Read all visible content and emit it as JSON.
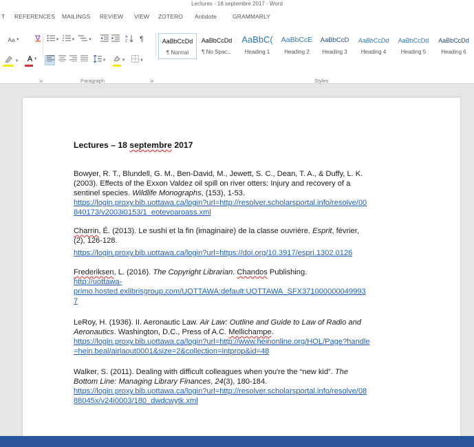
{
  "window": {
    "title": "Lectures - 18 septembre 2017 - Word"
  },
  "tabs": [
    {
      "label": "T"
    },
    {
      "label": "REFERENCES"
    },
    {
      "label": "MAILINGS"
    },
    {
      "label": "REVIEW"
    },
    {
      "label": "VIEW"
    },
    {
      "label": "ZOTERO"
    },
    {
      "label": "Antidote"
    },
    {
      "label": "GRAMMARLY"
    }
  ],
  "ribbon": {
    "font_size_glyph": "Aa",
    "paragraph_label": "Paragraph",
    "styles_label": "Styles",
    "colors": {
      "highlight": "#f4e80b",
      "font_color": "#d32f2f",
      "accent": "#2b579a",
      "link": "#1f5fb3"
    }
  },
  "styles": [
    {
      "sample": "AaBbCcDd",
      "name": "¶ Normal",
      "active": true
    },
    {
      "sample": "AaBbCcDd",
      "name": "¶ No Spac..."
    },
    {
      "sample": "AaBbC(",
      "name": "Heading 1"
    },
    {
      "sample": "AaBbCcE",
      "name": "Heading 2"
    },
    {
      "sample": "AaBbCcD",
      "name": "Heading 3"
    },
    {
      "sample": "AaBbCcDd",
      "name": "Heading 4"
    },
    {
      "sample": "AaBbCcDd",
      "name": "Heading 5"
    },
    {
      "sample": "AaBbCcDd",
      "name": "Heading 6"
    }
  ],
  "document": {
    "title_prefix": "Lectures – 18 ",
    "title_word": "septembre",
    "title_suffix": " 2017",
    "ref1": {
      "l1": "Bowyer, R. T., Blundell, G. M., Ben-David, M., Jewett, S. C., Dean, T. A., & Duffy, L. K.",
      "l2": "(2003). Effects of the Exxon Valdez oil spill on river otters: Injury and recovery of a",
      "l3a": "sentinel species. ",
      "l3b": "Wildlife Monographs",
      "l3c": ", (153), 1-53.",
      "link1": "https://login.proxy.bib.uottawa.ca/login?url=http://resolver.scholarsportal.info/resolve/00",
      "link2": "840173/v2003i0153/1_eotevoaroass.xml"
    },
    "ref2": {
      "author": "Charrin",
      "l1a": ", É. (2013). Le sushi et la fin (imaginaire) de la classe ouvrière. ",
      "l1b": "Esprit",
      "l1c": ", février,",
      "l2": "(2), 126-128.",
      "link1": "https://login.proxy.bib.uottawa.ca/login?url=https://doi.org/10.3917/espri.1302.0126"
    },
    "ref3": {
      "l1a": "Frederiksen",
      "l1b": ", L. (2016). ",
      "l1c": "The Copyright Librarian",
      "l1d": ". ",
      "l1e": "Chandos",
      "l1f": " Publishing.",
      "link1": "http://uottawa-",
      "link2": "primo.hosted.exlibrisgroup.com/UOTTAWA:default:UOTTAWA_SFX371000000049993",
      "link3": "7"
    },
    "ref4": {
      "l1a": "LeRoy, H. (1936). II. Aeronautic Law. ",
      "l1b": "Air Law: Outline and Guide to Law of Radio and",
      "l2a": "Aeronautics",
      "l2b": ". Washington, D.C., Press of A.C. ",
      "l2c": "Mellichampe",
      "l2d": ".",
      "link1": "https://login.proxy.bib.uottawa.ca/login?url=http://www.heinonline.org/HOL/Page?handle",
      "link2": "=hein.beal/airlaout0001&size=2&collection=intprop&id=48"
    },
    "ref5": {
      "l1a": "Walker, S. (2011). Dealing with difficult colleagues when you're the “new kid”. ",
      "l1b": "The",
      "l2a": "Bottom Line: Managing Library Finances",
      "l2b": ", ",
      "l2c": "24",
      "l2d": "(3), 180-184.",
      "link1": "https://login.proxy.bib.uottawa.ca/login?url=http://resolver.scholarsportal.info/resolve/08",
      "link2": "88045x/v24i0003/180_dwdcwytk.xml"
    }
  }
}
